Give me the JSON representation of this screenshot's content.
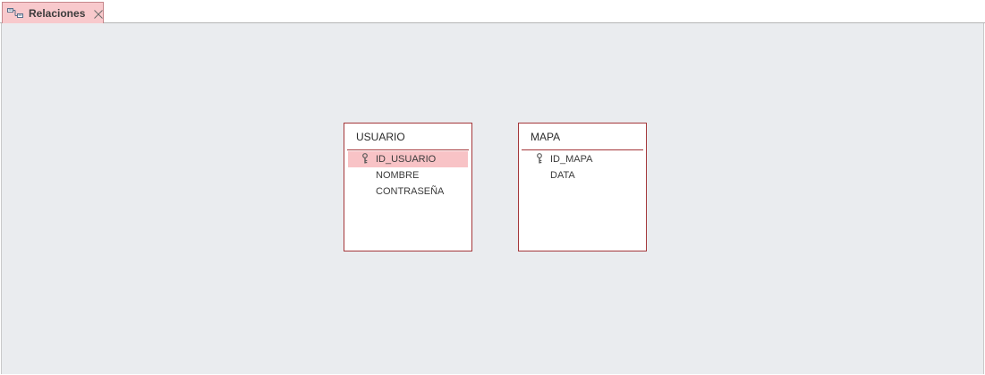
{
  "tab": {
    "label": "Relaciones",
    "icon": "relationships-icon",
    "close_icon": "close-icon"
  },
  "colors": {
    "tab_background": "#f8c9cc",
    "canvas_background": "#eaecef",
    "table_border": "#a4373a",
    "selected_field": "#f8c3c6"
  },
  "tables": {
    "usuario": {
      "title": "USUARIO",
      "fields": [
        {
          "name": "ID_USUARIO",
          "primary_key": true,
          "selected": true
        },
        {
          "name": "NOMBRE",
          "primary_key": false,
          "selected": false
        },
        {
          "name": "CONTRASEÑA",
          "primary_key": false,
          "selected": false
        }
      ]
    },
    "mapa": {
      "title": "MAPA",
      "fields": [
        {
          "name": "ID_MAPA",
          "primary_key": true,
          "selected": false
        },
        {
          "name": "DATA",
          "primary_key": false,
          "selected": false
        }
      ]
    }
  }
}
